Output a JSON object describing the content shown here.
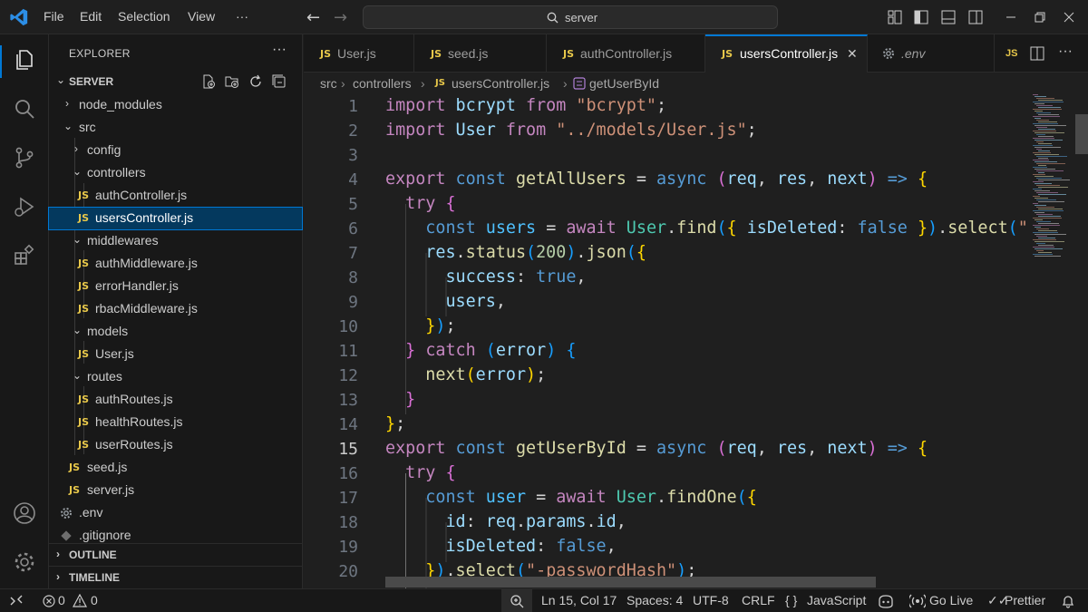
{
  "titlebar": {
    "menus": [
      "File",
      "Edit",
      "Selection",
      "View",
      "···"
    ],
    "search_text": "server"
  },
  "sidebar": {
    "title": "EXPLORER",
    "root": "SERVER",
    "tree": [
      {
        "label": "node_modules",
        "kind": "folder",
        "open": false,
        "depth": 1
      },
      {
        "label": "src",
        "kind": "folder",
        "open": true,
        "depth": 1
      },
      {
        "label": "config",
        "kind": "folder",
        "open": false,
        "depth": 2
      },
      {
        "label": "controllers",
        "kind": "folder",
        "open": true,
        "depth": 2
      },
      {
        "label": "authController.js",
        "kind": "js",
        "depth": 3
      },
      {
        "label": "usersController.js",
        "kind": "js",
        "depth": 3,
        "selected": true
      },
      {
        "label": "middlewares",
        "kind": "folder",
        "open": true,
        "depth": 2
      },
      {
        "label": "authMiddleware.js",
        "kind": "js",
        "depth": 3
      },
      {
        "label": "errorHandler.js",
        "kind": "js",
        "depth": 3
      },
      {
        "label": "rbacMiddleware.js",
        "kind": "js",
        "depth": 3
      },
      {
        "label": "models",
        "kind": "folder",
        "open": true,
        "depth": 2
      },
      {
        "label": "User.js",
        "kind": "js",
        "depth": 3
      },
      {
        "label": "routes",
        "kind": "folder",
        "open": true,
        "depth": 2
      },
      {
        "label": "authRoutes.js",
        "kind": "js",
        "depth": 3
      },
      {
        "label": "healthRoutes.js",
        "kind": "js",
        "depth": 3
      },
      {
        "label": "userRoutes.js",
        "kind": "js",
        "depth": 3
      },
      {
        "label": "seed.js",
        "kind": "js",
        "depth": 2
      },
      {
        "label": "server.js",
        "kind": "js",
        "depth": 2
      },
      {
        "label": ".env",
        "kind": "gear",
        "depth": 1
      },
      {
        "label": ".gitignore",
        "kind": "git",
        "depth": 1
      }
    ],
    "sections": [
      "OUTLINE",
      "TIMELINE"
    ]
  },
  "tabs": [
    {
      "label": "User.js",
      "icon": "JS"
    },
    {
      "label": "seed.js",
      "icon": "JS"
    },
    {
      "label": "authController.js",
      "icon": "JS"
    },
    {
      "label": "usersController.js",
      "icon": "JS",
      "active": true,
      "close": "✕"
    },
    {
      "label": ".env",
      "icon": "gear"
    }
  ],
  "breadcrumb": [
    "src",
    "controllers",
    "usersController.js",
    "getUserById"
  ],
  "editor": {
    "current_line": 15,
    "lines": [
      {
        "n": 1,
        "t": [
          [
            "import",
            "kw"
          ],
          [
            " ",
            "pl"
          ],
          [
            "bcrypt",
            "vr"
          ],
          [
            " ",
            "pl"
          ],
          [
            "from",
            "kw"
          ],
          [
            " ",
            "pl"
          ],
          [
            "\"bcrypt\"",
            "st"
          ],
          [
            ";",
            "pl"
          ]
        ]
      },
      {
        "n": 2,
        "t": [
          [
            "import",
            "kw"
          ],
          [
            " ",
            "pl"
          ],
          [
            "User",
            "vr"
          ],
          [
            " ",
            "pl"
          ],
          [
            "from",
            "kw"
          ],
          [
            " ",
            "pl"
          ],
          [
            "\"../models/User.js\"",
            "st"
          ],
          [
            ";",
            "pl"
          ]
        ]
      },
      {
        "n": 3,
        "t": []
      },
      {
        "n": 4,
        "t": [
          [
            "export",
            "kw"
          ],
          [
            " ",
            "pl"
          ],
          [
            "const",
            "bo"
          ],
          [
            " ",
            "pl"
          ],
          [
            "getAllUsers",
            "fn"
          ],
          [
            " = ",
            "pl"
          ],
          [
            "async",
            "bo"
          ],
          [
            " ",
            "pl"
          ],
          [
            "(",
            "b2"
          ],
          [
            "req",
            "vr"
          ],
          [
            ", ",
            "pl"
          ],
          [
            "res",
            "vr"
          ],
          [
            ", ",
            "pl"
          ],
          [
            "next",
            "vr"
          ],
          [
            ")",
            "b2"
          ],
          [
            " ",
            "pl"
          ],
          [
            "=>",
            "bo"
          ],
          [
            " ",
            "pl"
          ],
          [
            "{",
            "b1"
          ]
        ]
      },
      {
        "n": 5,
        "t": [
          [
            "  ",
            "pl"
          ],
          [
            "try",
            "kw"
          ],
          [
            " ",
            "pl"
          ],
          [
            "{",
            "b2"
          ]
        ]
      },
      {
        "n": 6,
        "t": [
          [
            "    ",
            "pl"
          ],
          [
            "const",
            "bo"
          ],
          [
            " ",
            "pl"
          ],
          [
            "users",
            "cn"
          ],
          [
            " = ",
            "pl"
          ],
          [
            "await",
            "kw"
          ],
          [
            " ",
            "pl"
          ],
          [
            "User",
            "ty"
          ],
          [
            ".",
            "pl"
          ],
          [
            "find",
            "fn"
          ],
          [
            "(",
            "b3"
          ],
          [
            "{",
            "b1"
          ],
          [
            " ",
            "pl"
          ],
          [
            "isDeleted",
            "vr"
          ],
          [
            ": ",
            "pl"
          ],
          [
            "false",
            "bo"
          ],
          [
            " ",
            "pl"
          ],
          [
            "}",
            "b1"
          ],
          [
            ")",
            "b3"
          ],
          [
            ".",
            "pl"
          ],
          [
            "select",
            "fn"
          ],
          [
            "(",
            "b3"
          ],
          [
            "\"",
            "st"
          ]
        ]
      },
      {
        "n": 7,
        "t": [
          [
            "    ",
            "pl"
          ],
          [
            "res",
            "vr"
          ],
          [
            ".",
            "pl"
          ],
          [
            "status",
            "fn"
          ],
          [
            "(",
            "b3"
          ],
          [
            "200",
            "nu"
          ],
          [
            ")",
            "b3"
          ],
          [
            ".",
            "pl"
          ],
          [
            "json",
            "fn"
          ],
          [
            "(",
            "b3"
          ],
          [
            "{",
            "b1"
          ]
        ]
      },
      {
        "n": 8,
        "t": [
          [
            "      ",
            "pl"
          ],
          [
            "success",
            "vr"
          ],
          [
            ": ",
            "pl"
          ],
          [
            "true",
            "bo"
          ],
          [
            ",",
            "pl"
          ]
        ]
      },
      {
        "n": 9,
        "t": [
          [
            "      ",
            "pl"
          ],
          [
            "users",
            "vr"
          ],
          [
            ",",
            "pl"
          ]
        ]
      },
      {
        "n": 10,
        "t": [
          [
            "    ",
            "pl"
          ],
          [
            "}",
            "b1"
          ],
          [
            ")",
            "b3"
          ],
          [
            ";",
            "pl"
          ]
        ]
      },
      {
        "n": 11,
        "t": [
          [
            "  ",
            "pl"
          ],
          [
            "}",
            "b2"
          ],
          [
            " ",
            "pl"
          ],
          [
            "catch",
            "kw"
          ],
          [
            " ",
            "pl"
          ],
          [
            "(",
            "b3"
          ],
          [
            "error",
            "vr"
          ],
          [
            ")",
            "b3"
          ],
          [
            " ",
            "pl"
          ],
          [
            "{",
            "b3"
          ]
        ]
      },
      {
        "n": 12,
        "t": [
          [
            "    ",
            "pl"
          ],
          [
            "next",
            "fn"
          ],
          [
            "(",
            "b1"
          ],
          [
            "error",
            "vr"
          ],
          [
            ")",
            "b1"
          ],
          [
            ";",
            "pl"
          ]
        ]
      },
      {
        "n": 13,
        "t": [
          [
            "  ",
            "pl"
          ],
          [
            "}",
            "b2"
          ]
        ]
      },
      {
        "n": 14,
        "t": [
          [
            "}",
            "b1"
          ],
          [
            ";",
            "pl"
          ]
        ]
      },
      {
        "n": 15,
        "t": [
          [
            "export",
            "kw"
          ],
          [
            " ",
            "pl"
          ],
          [
            "const",
            "bo"
          ],
          [
            " ",
            "pl"
          ],
          [
            "getUserById",
            "fn"
          ],
          [
            " = ",
            "pl"
          ],
          [
            "async",
            "bo"
          ],
          [
            " ",
            "pl"
          ],
          [
            "(",
            "b2"
          ],
          [
            "req",
            "vr"
          ],
          [
            ", ",
            "pl"
          ],
          [
            "res",
            "vr"
          ],
          [
            ", ",
            "pl"
          ],
          [
            "next",
            "vr"
          ],
          [
            ")",
            "b2"
          ],
          [
            " ",
            "pl"
          ],
          [
            "=>",
            "bo"
          ],
          [
            " ",
            "pl"
          ],
          [
            "{",
            "b1"
          ]
        ]
      },
      {
        "n": 16,
        "t": [
          [
            "  ",
            "pl"
          ],
          [
            "try",
            "kw"
          ],
          [
            " ",
            "pl"
          ],
          [
            "{",
            "b2"
          ]
        ]
      },
      {
        "n": 17,
        "t": [
          [
            "    ",
            "pl"
          ],
          [
            "const",
            "bo"
          ],
          [
            " ",
            "pl"
          ],
          [
            "user",
            "cn"
          ],
          [
            " = ",
            "pl"
          ],
          [
            "await",
            "kw"
          ],
          [
            " ",
            "pl"
          ],
          [
            "User",
            "ty"
          ],
          [
            ".",
            "pl"
          ],
          [
            "findOne",
            "fn"
          ],
          [
            "(",
            "b3"
          ],
          [
            "{",
            "b1"
          ]
        ]
      },
      {
        "n": 18,
        "t": [
          [
            "      ",
            "pl"
          ],
          [
            "id",
            "vr"
          ],
          [
            ": ",
            "pl"
          ],
          [
            "req",
            "vr"
          ],
          [
            ".",
            "pl"
          ],
          [
            "params",
            "vr"
          ],
          [
            ".",
            "pl"
          ],
          [
            "id",
            "vr"
          ],
          [
            ",",
            "pl"
          ]
        ]
      },
      {
        "n": 19,
        "t": [
          [
            "      ",
            "pl"
          ],
          [
            "isDeleted",
            "vr"
          ],
          [
            ": ",
            "pl"
          ],
          [
            "false",
            "bo"
          ],
          [
            ",",
            "pl"
          ]
        ]
      },
      {
        "n": 20,
        "t": [
          [
            "    ",
            "pl"
          ],
          [
            "}",
            "b1"
          ],
          [
            ")",
            "b3"
          ],
          [
            ".",
            "pl"
          ],
          [
            "select",
            "fn"
          ],
          [
            "(",
            "b3"
          ],
          [
            "\"-passwordHash\"",
            "st"
          ],
          [
            ")",
            "b3"
          ],
          [
            ";",
            "pl"
          ]
        ]
      }
    ]
  },
  "status": {
    "errors": "0",
    "warnings": "0",
    "position": "Ln 15, Col 17",
    "spaces": "Spaces: 4",
    "encoding": "UTF-8",
    "eol": "CRLF",
    "lang_braces": "{ }",
    "language": "JavaScript",
    "golive": "Go Live",
    "prettier": "Prettier"
  },
  "colors": {
    "accent": "#0078d4",
    "js_icon": "#e8c84a",
    "selection": "#04395e"
  }
}
